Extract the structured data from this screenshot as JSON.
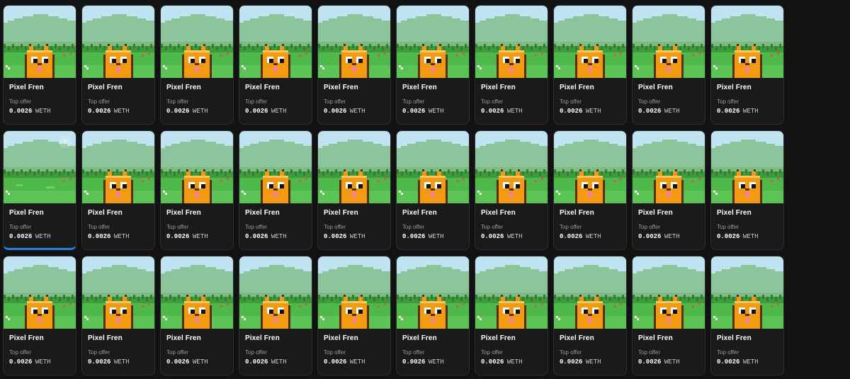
{
  "grid": {
    "columns": 10,
    "cards": [
      {
        "name": "Pixel Fren",
        "offer_label": "Top offer",
        "price": "0.0026",
        "currency": "WETH",
        "variant": "cat",
        "selected": false
      },
      {
        "name": "Pixel Fren",
        "offer_label": "Top offer",
        "price": "0.0026",
        "currency": "WETH",
        "variant": "cat",
        "selected": false
      },
      {
        "name": "Pixel Fren",
        "offer_label": "Top offer",
        "price": "0.0026",
        "currency": "WETH",
        "variant": "cat",
        "selected": false
      },
      {
        "name": "Pixel Fren",
        "offer_label": "Top offer",
        "price": "0.0026",
        "currency": "WETH",
        "variant": "cat",
        "selected": false
      },
      {
        "name": "Pixel Fren",
        "offer_label": "Top offer",
        "price": "0.0026",
        "currency": "WETH",
        "variant": "cat",
        "selected": false
      },
      {
        "name": "Pixel Fren",
        "offer_label": "Top offer",
        "price": "0.0026",
        "currency": "WETH",
        "variant": "cat",
        "selected": false
      },
      {
        "name": "Pixel Fren",
        "offer_label": "Top offer",
        "price": "0.0026",
        "currency": "WETH",
        "variant": "cat",
        "selected": false
      },
      {
        "name": "Pixel Fren",
        "offer_label": "Top offer",
        "price": "0.0026",
        "currency": "WETH",
        "variant": "cat",
        "selected": false
      },
      {
        "name": "Pixel Fren",
        "offer_label": "Top offer",
        "price": "0.0026",
        "currency": "WETH",
        "variant": "cat",
        "selected": false
      },
      {
        "name": "Pixel Fren",
        "offer_label": "Top offer",
        "price": "0.0026",
        "currency": "WETH",
        "variant": "cat",
        "selected": false
      },
      {
        "name": "Pixel Fren",
        "offer_label": "Top offer",
        "price": "0.0026",
        "currency": "WETH",
        "variant": "empty",
        "selected": true,
        "add_icon": "plus-icon"
      },
      {
        "name": "Pixel Fren",
        "offer_label": "Top offer",
        "price": "0.0026",
        "currency": "WETH",
        "variant": "cat",
        "selected": false
      },
      {
        "name": "Pixel Fren",
        "offer_label": "Top offer",
        "price": "0.0026",
        "currency": "WETH",
        "variant": "cat",
        "selected": false
      },
      {
        "name": "Pixel Fren",
        "offer_label": "Top offer",
        "price": "0.0026",
        "currency": "WETH",
        "variant": "cat",
        "selected": false
      },
      {
        "name": "Pixel Fren",
        "offer_label": "Top offer",
        "price": "0.0026",
        "currency": "WETH",
        "variant": "cat",
        "selected": false
      },
      {
        "name": "Pixel Fren",
        "offer_label": "Top offer",
        "price": "0.0026",
        "currency": "WETH",
        "variant": "cat",
        "selected": false
      },
      {
        "name": "Pixel Fren",
        "offer_label": "Top offer",
        "price": "0.0026",
        "currency": "WETH",
        "variant": "cat",
        "selected": false
      },
      {
        "name": "Pixel Fren",
        "offer_label": "Top offer",
        "price": "0.0026",
        "currency": "WETH",
        "variant": "cat",
        "selected": false
      },
      {
        "name": "Pixel Fren",
        "offer_label": "Top offer",
        "price": "0.0026",
        "currency": "WETH",
        "variant": "cat",
        "selected": false
      },
      {
        "name": "Pixel Fren",
        "offer_label": "Top offer",
        "price": "0.0026",
        "currency": "WETH",
        "variant": "cat",
        "selected": false
      },
      {
        "name": "Pixel Fren",
        "offer_label": "Top offer",
        "price": "0.0026",
        "currency": "WETH",
        "variant": "cat",
        "selected": false
      },
      {
        "name": "Pixel Fren",
        "offer_label": "Top offer",
        "price": "0.0026",
        "currency": "WETH",
        "variant": "cat",
        "selected": false
      },
      {
        "name": "Pixel Fren",
        "offer_label": "Top offer",
        "price": "0.0026",
        "currency": "WETH",
        "variant": "cat",
        "selected": false
      },
      {
        "name": "Pixel Fren",
        "offer_label": "Top offer",
        "price": "0.0026",
        "currency": "WETH",
        "variant": "cat",
        "selected": false
      },
      {
        "name": "Pixel Fren",
        "offer_label": "Top offer",
        "price": "0.0026",
        "currency": "WETH",
        "variant": "cat",
        "selected": false
      },
      {
        "name": "Pixel Fren",
        "offer_label": "Top offer",
        "price": "0.0026",
        "currency": "WETH",
        "variant": "cat",
        "selected": false
      },
      {
        "name": "Pixel Fren",
        "offer_label": "Top offer",
        "price": "0.0026",
        "currency": "WETH",
        "variant": "cat",
        "selected": false
      },
      {
        "name": "Pixel Fren",
        "offer_label": "Top offer",
        "price": "0.0026",
        "currency": "WETH",
        "variant": "cat",
        "selected": false
      },
      {
        "name": "Pixel Fren",
        "offer_label": "Top offer",
        "price": "0.0026",
        "currency": "WETH",
        "variant": "cat",
        "selected": false
      },
      {
        "name": "Pixel Fren",
        "offer_label": "Top offer",
        "price": "0.0026",
        "currency": "WETH",
        "variant": "cat",
        "selected": false
      }
    ]
  },
  "colors": {
    "background": "#121212",
    "card": "#1a1a1b",
    "accent": "#2081e2",
    "sky": "#bfe3f0",
    "hills": "#8cc49c",
    "grass": "#4fb84a",
    "cat": "#f29a12"
  }
}
